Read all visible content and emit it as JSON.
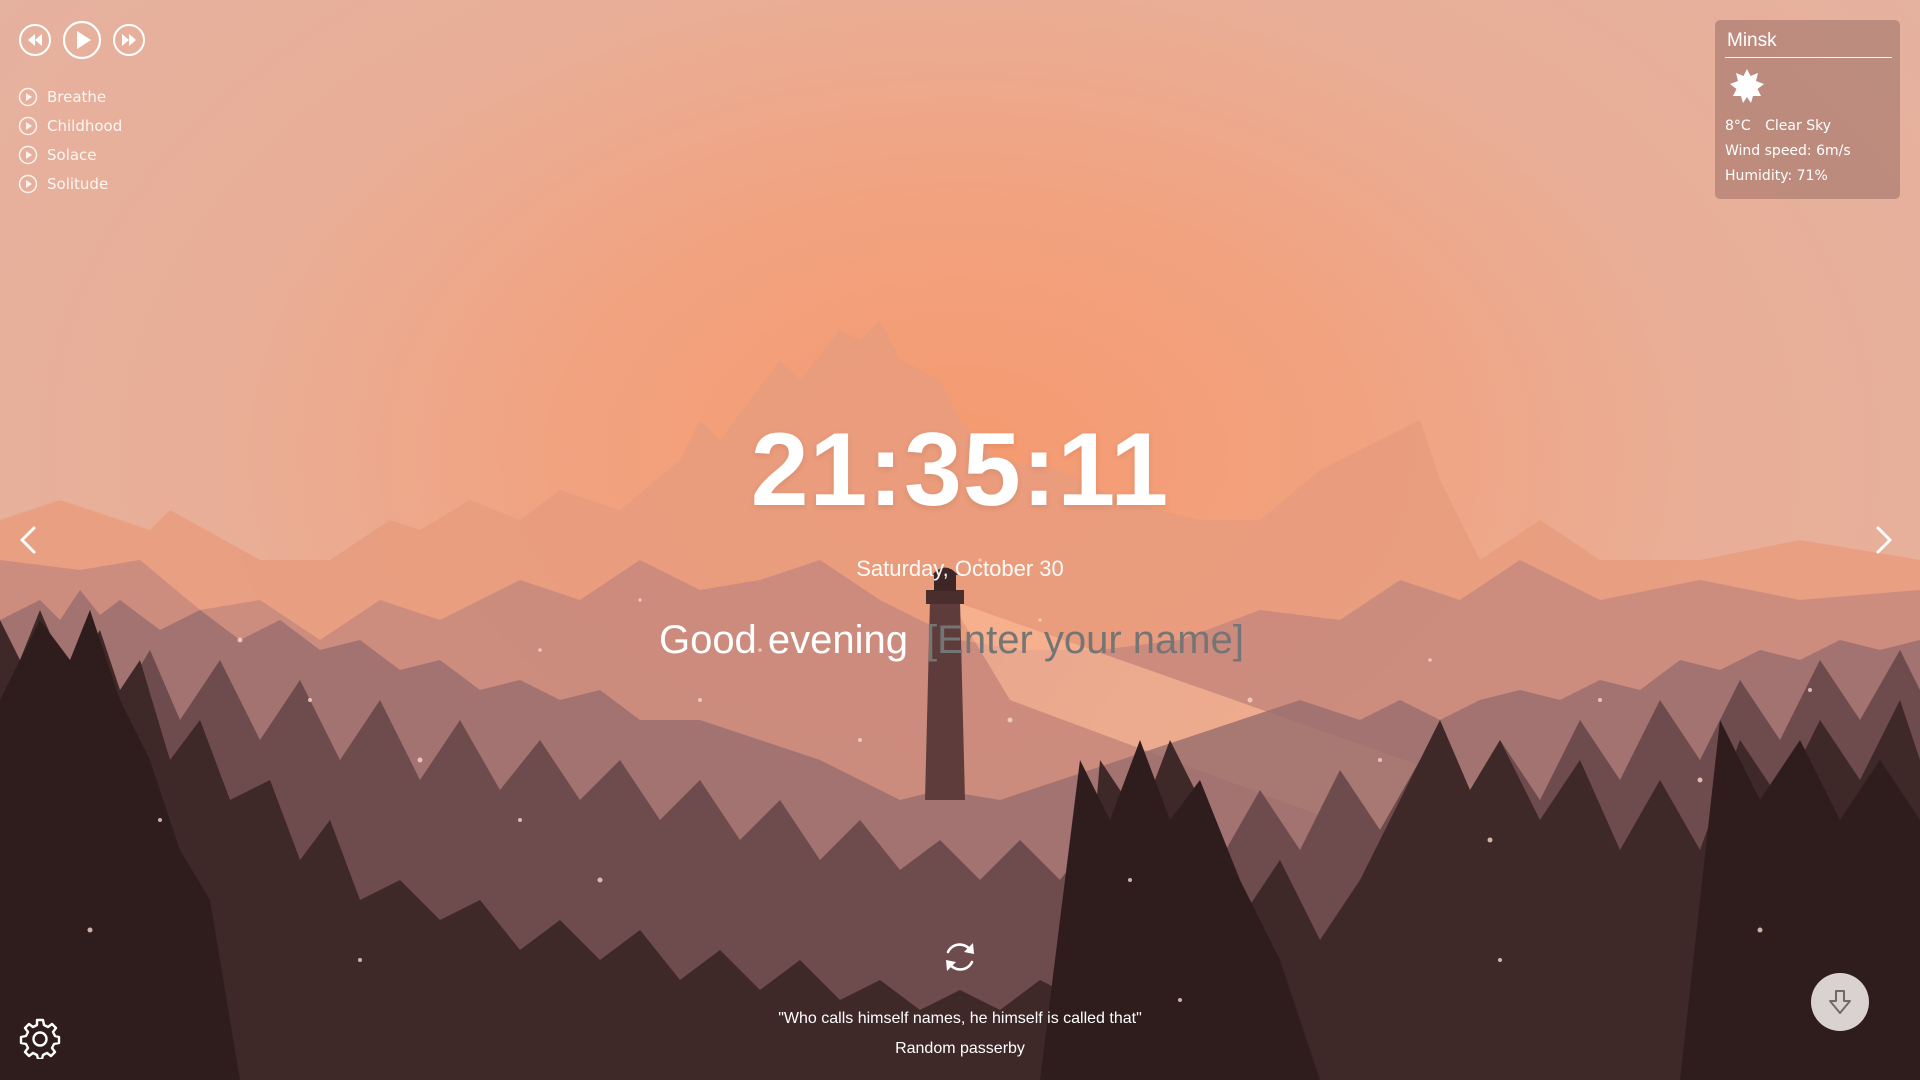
{
  "player": {
    "controls": [
      "prev-icon",
      "play-icon",
      "next-icon"
    ],
    "tracks": [
      {
        "label": "Breathe"
      },
      {
        "label": "Childhood"
      },
      {
        "label": "Solace"
      },
      {
        "label": "Solitude"
      }
    ]
  },
  "weather": {
    "city": "Minsk",
    "icon": "clear-sky-icon",
    "temperature": "8°C",
    "description": "Clear Sky",
    "wind": "Wind speed: 6m/s",
    "humidity": "Humidity: 71%"
  },
  "clock": {
    "time": "21:35:11",
    "date": "Saturday, October 30"
  },
  "greeting": {
    "text": "Good evening",
    "name_placeholder": "[Enter your name]"
  },
  "quote": {
    "text": "\"Who calls himself names, he himself is called that\"",
    "author": "Random passerby"
  },
  "colors": {
    "sky_center": "#f59a70",
    "sky_edge": "#e3b3a2",
    "forest_dark": "#3a2424"
  }
}
